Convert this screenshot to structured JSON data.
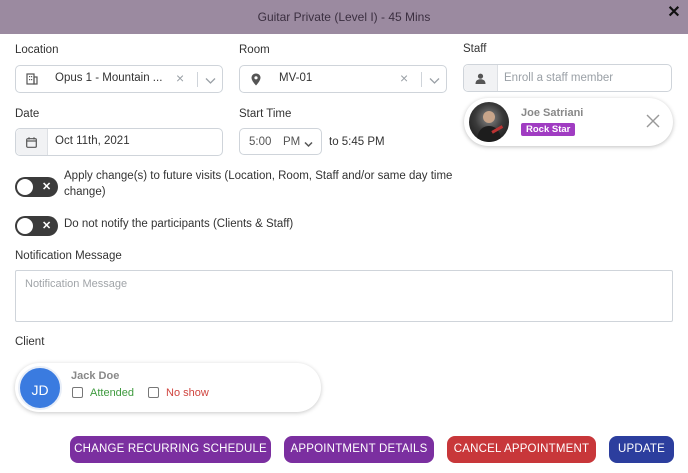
{
  "dialog": {
    "title": "Guitar Private (Level I) - 45 Mins",
    "close_symbol": "✕"
  },
  "location": {
    "label": "Location",
    "value": "Opus 1 - Mountain ...",
    "icon": "building-icon"
  },
  "room": {
    "label": "Room",
    "value": "MV-01",
    "icon": "map-pin-icon"
  },
  "staff": {
    "label": "Staff",
    "placeholder": "Enroll a staff member",
    "member": {
      "name": "Joe Satriani",
      "badge": "Rock Star"
    }
  },
  "date": {
    "label": "Date",
    "value": "Oct 11th, 2021",
    "icon": "calendar-icon"
  },
  "start_time": {
    "label": "Start Time",
    "time": "5:00",
    "ampm": "PM",
    "end_text": "to 5:45 PM"
  },
  "toggles": [
    {
      "text": "Apply change(s) to future visits (Location, Room, Staff and/or same day time change)",
      "on": false,
      "symbol": "✕"
    },
    {
      "text": "Do not notify the participants (Clients & Staff)",
      "on": false,
      "symbol": "✕"
    }
  ],
  "notification": {
    "label": "Notification Message",
    "placeholder": "Notification Message"
  },
  "client": {
    "label": "Client",
    "name": "Jack Doe",
    "initials": "JD",
    "attended_label": "Attended",
    "noshow_label": "No show",
    "attended": false,
    "noshow": false
  },
  "buttons": {
    "change_recurring": "CHANGE RECURRING SCHEDULE",
    "appointment_details": "APPOINTMENT DETAILS",
    "cancel_appointment": "CANCEL APPOINTMENT",
    "update": "UPDATE"
  },
  "colors": {
    "header": "#9b8aa0",
    "purple_button": "#7b2fa0",
    "cancel_button": "#c8373a",
    "update_button": "#2c3e9e",
    "badge": "#a03cc2",
    "attended": "#3e9a3e",
    "noshow": "#d0453f",
    "client_avatar": "#3a7be0"
  }
}
